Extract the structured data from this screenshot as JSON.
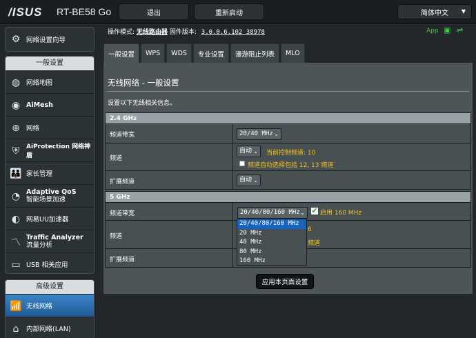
{
  "header": {
    "brand": "/ISUS",
    "model": "RT-BE58 Go",
    "logout_label": "退出",
    "reboot_label": "重新启动",
    "language": "简体中文"
  },
  "info": {
    "mode_label": "操作模式:",
    "mode_value": "无线路由器",
    "fw_label": "固件版本:",
    "fw_value": "3.0.0.6.102_38978",
    "app_label": "App"
  },
  "sidebar": {
    "setup_wizard": "网络设置向导",
    "general_header": "一般设置",
    "general_items": [
      {
        "label": "网络地图",
        "icon": "network-map-icon"
      },
      {
        "label": "AiMesh",
        "icon": "aimesh-icon"
      },
      {
        "label": "网络",
        "icon": "globe-icon"
      },
      {
        "label": "AiProtection 网络神盾",
        "icon": "shield-icon"
      },
      {
        "label": "家长管理",
        "icon": "parental-icon"
      },
      {
        "label": "Adaptive QoS",
        "label2": "智能场景加速",
        "icon": "qos-icon"
      },
      {
        "label": "网易UU加速器",
        "icon": "uu-accelerator-icon"
      },
      {
        "label": "Traffic Analyzer",
        "label2": "流量分析",
        "icon": "traffic-icon"
      },
      {
        "label": "USB 相关应用",
        "icon": "usb-icon"
      }
    ],
    "advanced_header": "高级设置",
    "advanced_items": [
      {
        "label": "无线网络",
        "icon": "wifi-icon"
      },
      {
        "label": "内部网络(LAN)",
        "icon": "lan-icon"
      }
    ]
  },
  "tabs": [
    "一般设置",
    "WPS",
    "WDS",
    "专业设置",
    "漫游阻止列表",
    "MLO"
  ],
  "panel": {
    "title": "无线网络 - 一般设置",
    "description": "设置以下无线相关信息。",
    "band24": {
      "header": "2.4 GHz",
      "bandwidth_label": "频道带宽",
      "bandwidth_value": "20/40 MHz",
      "channel_label": "频道",
      "channel_value": "自动",
      "current_channel": "当前控制频道: 10",
      "auto_select_note": "频道自动选择包括 12, 13 频道",
      "ext_channel_label": "扩展频道",
      "ext_channel_value": "自动"
    },
    "band5": {
      "header": "5 GHz",
      "bandwidth_label": "频道带宽",
      "bandwidth_value": "20/40/80/160 MHz",
      "enable160": "启用 160 MHz",
      "channel_label": "频道",
      "channel_note_tail": "6",
      "channel_note2_tail": "频道",
      "ext_channel_label": "扩展频道"
    },
    "dropdown_options": [
      "20/40/80/160 MHz",
      "20 MHz",
      "40 MHz",
      "80 MHz",
      "160 MHz"
    ],
    "apply_label": "应用本页面设置"
  }
}
